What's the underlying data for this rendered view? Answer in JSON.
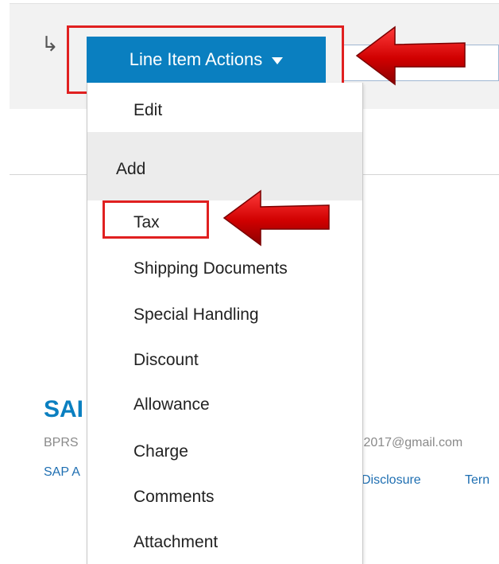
{
  "line_item": {
    "indent_glyph": "↳",
    "actions_button_label": "Line Item Actions",
    "caret_icon": "caret-down-icon"
  },
  "menu": {
    "items_top": [
      {
        "label": "Edit"
      }
    ],
    "group_label": "Add",
    "add_items": [
      {
        "label": "Tax"
      },
      {
        "label": "Shipping Documents"
      },
      {
        "label": "Special Handling"
      },
      {
        "label": "Discount"
      },
      {
        "label": "Allowance"
      },
      {
        "label": "Charge"
      },
      {
        "label": "Comments"
      },
      {
        "label": "Attachment"
      }
    ]
  },
  "footer": {
    "logo_text": "SAI",
    "left_text": "BPRS",
    "email_fragment": ":2017@gmail.com",
    "link_left": "SAP A",
    "link_disclosure": "Disclosure",
    "link_terms": "Tern"
  },
  "colors": {
    "accent_blue": "#0a7fc0",
    "highlight_red": "#e02020"
  }
}
